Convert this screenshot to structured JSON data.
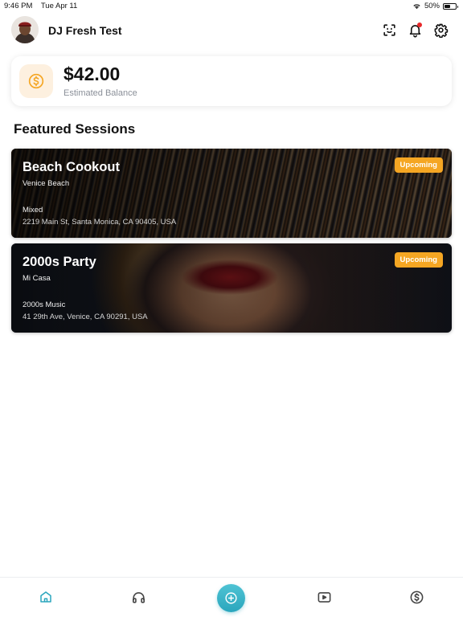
{
  "status_bar": {
    "time": "9:46 PM",
    "date": "Tue Apr 11",
    "battery": "50%"
  },
  "header": {
    "user_name": "DJ Fresh Test"
  },
  "balance": {
    "amount": "$42.00",
    "label": "Estimated Balance"
  },
  "featured": {
    "title": "Featured Sessions",
    "sessions": [
      {
        "title": "Beach Cookout",
        "venue": "Venice Beach",
        "genre": "Mixed",
        "address": "2219 Main St, Santa Monica, CA 90405, USA",
        "status": "Upcoming"
      },
      {
        "title": "2000s Party",
        "venue": "Mi Casa",
        "genre": "2000s Music",
        "address": "41 29th Ave, Venice, CA 90291, USA",
        "status": "Upcoming"
      }
    ]
  },
  "colors": {
    "accent": "#2aa6bd",
    "badge": "#f5a623",
    "coin": "#f5a623",
    "notification": "#e8282a"
  },
  "nav": {
    "items": [
      "home-icon",
      "headphones-icon",
      "add-icon",
      "video-icon",
      "dollar-icon"
    ],
    "active": "home-icon"
  }
}
